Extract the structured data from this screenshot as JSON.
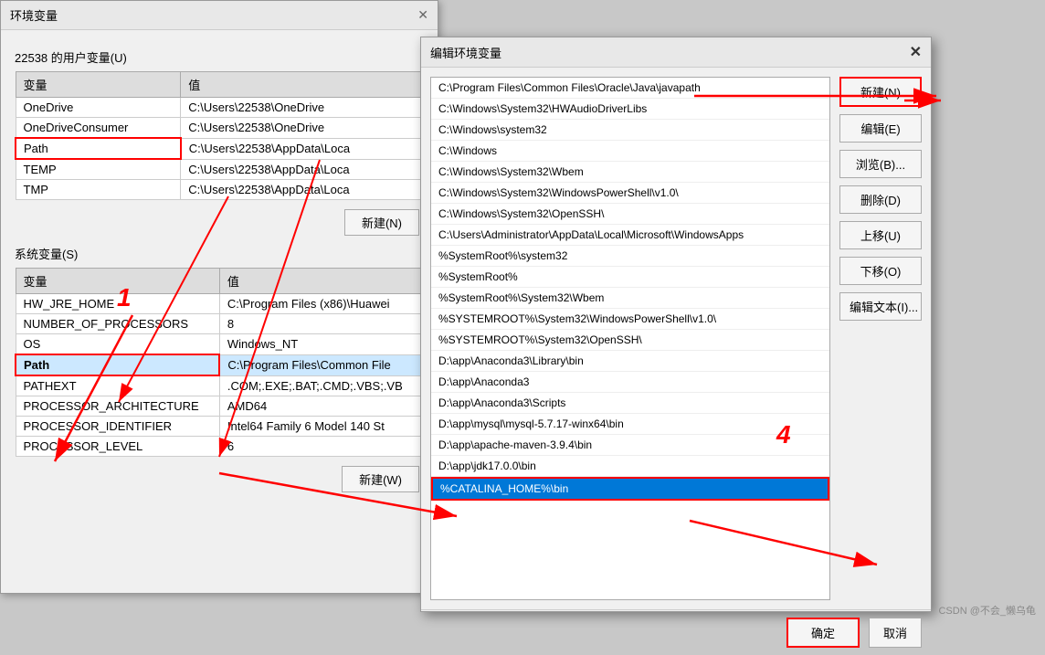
{
  "bgWindow": {
    "title": "环境变量",
    "userSection": "22538 的用户变量(U)",
    "systemSection": "系统变量(S)",
    "colVar": "变量",
    "colVal": "值",
    "userVars": [
      {
        "name": "OneDrive",
        "value": "C:\\Users\\22538\\OneDrive"
      },
      {
        "name": "OneDriveConsumer",
        "value": "C:\\Users\\22538\\OneDrive"
      },
      {
        "name": "Path",
        "value": "C:\\Users\\22538\\AppData\\Loca",
        "highlight": true
      },
      {
        "name": "TEMP",
        "value": "C:\\Users\\22538\\AppData\\Loca"
      },
      {
        "name": "TMP",
        "value": "C:\\Users\\22538\\AppData\\Loca"
      }
    ],
    "systemVars": [
      {
        "name": "HW_JRE_HOME",
        "value": "C:\\Program Files (x86)\\Huawei"
      },
      {
        "name": "NUMBER_OF_PROCESSORS",
        "value": "8"
      },
      {
        "name": "OS",
        "value": "Windows_NT"
      },
      {
        "name": "Path",
        "value": "C:\\Program Files\\Common File",
        "highlight": true,
        "selected": true
      },
      {
        "name": "PATHEXT",
        "value": ".COM;.EXE;.BAT;.CMD;.VBS;.VB"
      },
      {
        "name": "PROCESSOR_ARCHITECTURE",
        "value": "AMD64"
      },
      {
        "name": "PROCESSOR_IDENTIFIER",
        "value": "Intel64 Family 6 Model 140 St"
      },
      {
        "name": "PROCESSOR_LEVEL",
        "value": "6"
      }
    ],
    "newBtnUser": "新建(N)",
    "newBtnSystem": "新建(W)"
  },
  "editDialog": {
    "title": "编辑环境变量",
    "pathItems": [
      {
        "text": "C:\\Program Files\\Common Files\\Oracle\\Java\\javapath",
        "selected": false
      },
      {
        "text": "C:\\Windows\\System32\\HWAudioDriverLibs",
        "selected": false
      },
      {
        "text": "C:\\Windows\\system32",
        "selected": false
      },
      {
        "text": "C:\\Windows",
        "selected": false
      },
      {
        "text": "C:\\Windows\\System32\\Wbem",
        "selected": false
      },
      {
        "text": "C:\\Windows\\System32\\WindowsPowerShell\\v1.0\\",
        "selected": false
      },
      {
        "text": "C:\\Windows\\System32\\OpenSSH\\",
        "selected": false
      },
      {
        "text": "C:\\Users\\Administrator\\AppData\\Local\\Microsoft\\WindowsApps",
        "selected": false
      },
      {
        "text": "%SystemRoot%\\system32",
        "selected": false
      },
      {
        "text": "%SystemRoot%",
        "selected": false
      },
      {
        "text": "%SystemRoot%\\System32\\Wbem",
        "selected": false
      },
      {
        "text": "%SYSTEMROOT%\\System32\\WindowsPowerShell\\v1.0\\",
        "selected": false
      },
      {
        "text": "%SYSTEMROOT%\\System32\\OpenSSH\\",
        "selected": false
      },
      {
        "text": "D:\\app\\Anaconda3\\Library\\bin",
        "selected": false
      },
      {
        "text": "D:\\app\\Anaconda3",
        "selected": false
      },
      {
        "text": "D:\\app\\Anaconda3\\Scripts",
        "selected": false
      },
      {
        "text": "D:\\app\\mysql\\mysql-5.7.17-winx64\\bin",
        "selected": false
      },
      {
        "text": "D:\\app\\apache-maven-3.9.4\\bin",
        "selected": false
      },
      {
        "text": "D:\\app\\jdk17.0.0\\bin",
        "selected": false
      },
      {
        "text": "%CATALINA_HOME%\\bin",
        "selected": true,
        "highlighted": true
      }
    ],
    "buttons": {
      "new": "新建(N)",
      "edit": "编辑(E)",
      "browse": "浏览(B)...",
      "delete": "删除(D)",
      "moveUp": "上移(U)",
      "moveDown": "下移(O)",
      "editText": "编辑文本(I)..."
    },
    "confirmBtn": "确定",
    "cancelBtn": "取消"
  },
  "watermark": "CSDN @不会_懒乌龟",
  "numbers": {
    "one": "1",
    "four": "4"
  }
}
